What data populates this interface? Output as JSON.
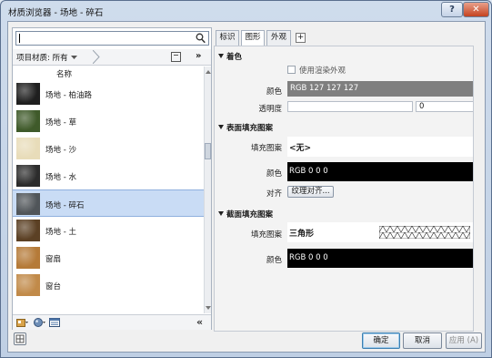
{
  "window": {
    "title": "材质浏览器 - 场地 - 碎石",
    "help_label": "?",
    "close_label": "✕"
  },
  "search": {
    "value": "",
    "icon": "search-icon"
  },
  "filter": {
    "label": "项目材质: 所有",
    "more_label": "»"
  },
  "list": {
    "column_header": "名称",
    "items": [
      {
        "name": "场地 - 柏油路",
        "swatch": "#1f1f1f",
        "selected": false
      },
      {
        "name": "场地 - 草",
        "swatch": "#3f5a2a",
        "selected": false
      },
      {
        "name": "场地 - 沙",
        "swatch": "#e8dcb9",
        "selected": false
      },
      {
        "name": "场地 - 水",
        "swatch": "#2c2c2c",
        "selected": false
      },
      {
        "name": "场地 - 碎石",
        "swatch": "#505559",
        "selected": true
      },
      {
        "name": "场地 - 土",
        "swatch": "#5b4024",
        "selected": false
      },
      {
        "name": "窗扇",
        "swatch": "#b57a38",
        "selected": false
      },
      {
        "name": "窗台",
        "swatch": "#c18a49",
        "selected": false
      }
    ]
  },
  "tabs": [
    {
      "label": "标识",
      "active": false
    },
    {
      "label": "图形",
      "active": true
    },
    {
      "label": "外观",
      "active": false
    }
  ],
  "tab_add_label": "+",
  "shading": {
    "title": "着色",
    "use_render_label": "使用渲染外观",
    "color_label": "颜色",
    "color_value": "RGB 127 127 127",
    "color_hex": "#7f7f7f",
    "transparency_label": "透明度",
    "transparency_value": "0"
  },
  "surface_pattern": {
    "title": "表面填充图案",
    "fill_label": "填充图案",
    "fill_value": "<无>",
    "color_label": "颜色",
    "color_value": "RGB 0 0 0",
    "align_label": "对齐",
    "align_button": "纹理对齐..."
  },
  "cut_pattern": {
    "title": "截面填充图案",
    "fill_label": "填充图案",
    "fill_value": "三角形",
    "color_label": "颜色",
    "color_value": "RGB 0 0 0"
  },
  "buttons": {
    "ok": "确定",
    "cancel": "取消",
    "apply": "应用 (A)"
  }
}
